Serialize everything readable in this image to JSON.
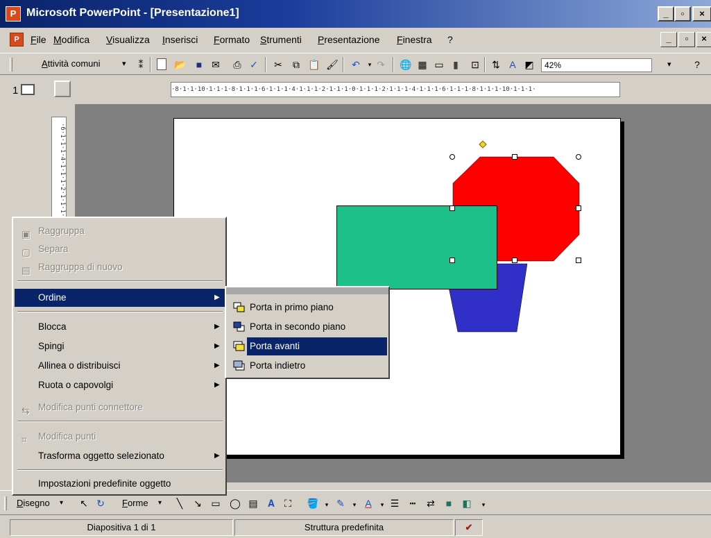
{
  "window": {
    "title": "Microsoft PowerPoint - [Presentazione1]",
    "app_icon": "powerpoint-icon",
    "controls": [
      "minimize",
      "restore",
      "close"
    ]
  },
  "menubar": {
    "items": [
      "File",
      "Modifica",
      "Visualizza",
      "Inserisci",
      "Formato",
      "Strumenti",
      "Presentazione",
      "Finestra",
      "?"
    ]
  },
  "toolbar": {
    "common_tasks_label": "Attività comuni",
    "zoom": "42%"
  },
  "outline": {
    "slide_number": "1"
  },
  "ruler": {
    "horizontal_text": "·8·1·1·10·1·1·1·8·1·1·1·6·1·1·1·4·1·1·1·2·1·1·1·0·1·1·1·2·1·1·1·4·1·1·1·6·1·1·1·8·1·1·1·10·1·1·1·",
    "vertical_text": "·6·1·1·1·4·1·1·1·2·1·1·1·0·"
  },
  "slide": {
    "shapes": [
      {
        "name": "octagon",
        "color": "#ff0000"
      },
      {
        "name": "trapezoid",
        "color": "#3030c8"
      },
      {
        "name": "rectangle",
        "color": "#1ec08a"
      }
    ]
  },
  "context_menu": {
    "items": [
      {
        "label": "Raggruppa",
        "enabled": false
      },
      {
        "label": "Separa",
        "enabled": false
      },
      {
        "label": "Raggruppa di nuovo",
        "enabled": false
      },
      {
        "label": "Ordine",
        "enabled": true,
        "highlighted": true,
        "submenu": true
      },
      {
        "label": "Blocca",
        "enabled": true,
        "submenu": true
      },
      {
        "label": "Spingi",
        "enabled": true,
        "submenu": true
      },
      {
        "label": "Allinea o distribuisci",
        "enabled": true,
        "submenu": true
      },
      {
        "label": "Ruota o capovolgi",
        "enabled": true,
        "submenu": true
      },
      {
        "label": "Modifica punti connettore",
        "enabled": false
      },
      {
        "label": "Modifica punti",
        "enabled": false
      },
      {
        "label": "Trasforma oggetto selezionato",
        "enabled": true,
        "submenu": true
      },
      {
        "label": "Impostazioni predefinite oggetto",
        "enabled": true
      }
    ]
  },
  "submenu_ordine": {
    "items": [
      {
        "label": "Porta in primo piano",
        "icon": "bring-to-front-icon"
      },
      {
        "label": "Porta in secondo piano",
        "icon": "send-to-back-icon"
      },
      {
        "label": "Porta avanti",
        "icon": "bring-forward-icon",
        "highlighted": true
      },
      {
        "label": "Porta indietro",
        "icon": "send-backward-icon"
      }
    ]
  },
  "drawing_toolbar": {
    "draw_label": "Disegno",
    "shapes_label": "Forme"
  },
  "statusbar": {
    "slide_info": "Diapositiva 1 di 1",
    "design": "Struttura predefinita"
  }
}
